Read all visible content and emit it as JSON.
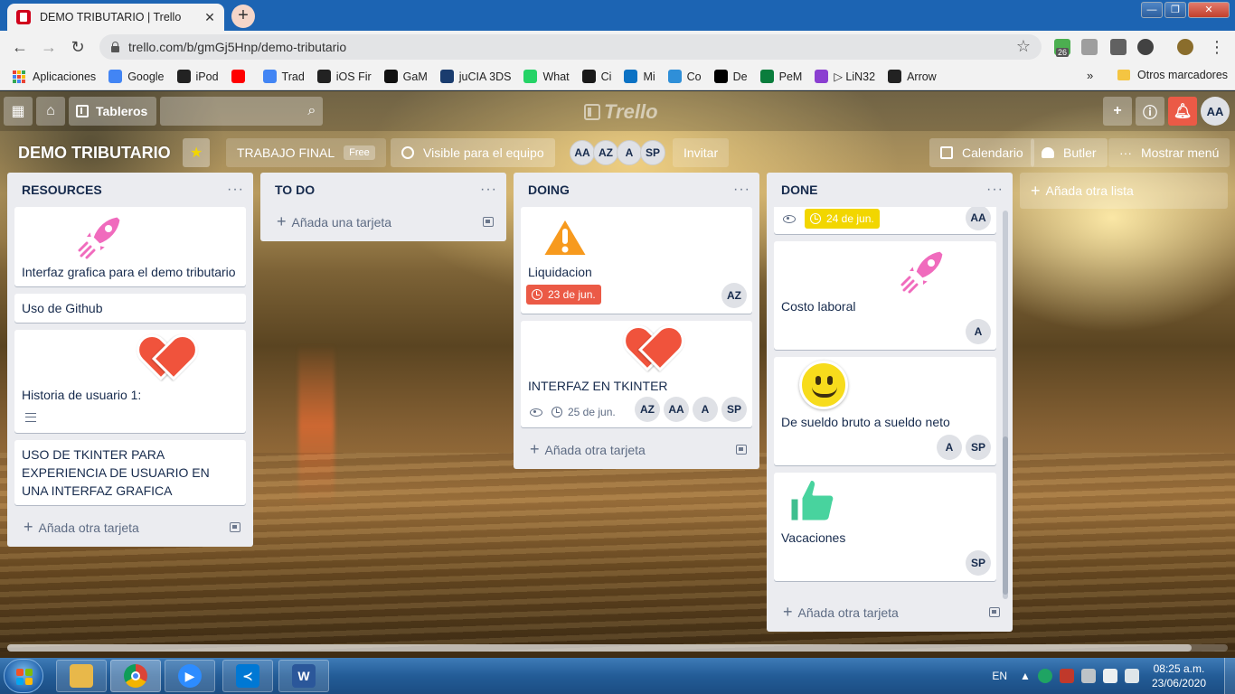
{
  "browser": {
    "tab_title": "DEMO TRIBUTARIO | Trello",
    "tab_close": "✕",
    "new_tab": "+",
    "url": "trello.com/b/gmGj5Hnp/demo-tributario",
    "extension_badge": "26",
    "window_controls": {
      "minimize": "—",
      "maximize": "❐",
      "close": "✕"
    }
  },
  "bookmarks": {
    "items": [
      {
        "label": "Aplicaciones",
        "icon": "apps-grid-icon"
      },
      {
        "label": "Google",
        "icon": "google-icon",
        "color": "#4285f4"
      },
      {
        "label": "iPod",
        "icon": "globe-icon",
        "color": "#222222"
      },
      {
        "label": "",
        "icon": "youtube-icon",
        "color": "#ff0000"
      },
      {
        "label": "Trad",
        "icon": "translate-icon",
        "color": "#4285f4"
      },
      {
        "label": "iOS Fir",
        "icon": "globe-icon",
        "color": "#222222"
      },
      {
        "label": "GaM",
        "icon": "gam-icon",
        "color": "#111111"
      },
      {
        "label": "juCIA 3DS",
        "icon": "jucia-icon",
        "color": "#1a3c6e"
      },
      {
        "label": "What",
        "icon": "whatsapp-icon",
        "color": "#25d366"
      },
      {
        "label": "Ci",
        "icon": "ci-icon",
        "color": "#1a1a1a"
      },
      {
        "label": "Mi",
        "icon": "mi-icon",
        "color": "#0b72c4"
      },
      {
        "label": "Co",
        "icon": "co-icon",
        "color": "#2f8fd8"
      },
      {
        "label": "De",
        "icon": "dc-icon",
        "color": "#000000"
      },
      {
        "label": "PeM",
        "icon": "pem-icon",
        "color": "#0a7d3c"
      },
      {
        "label": "▷ LiN32",
        "icon": "lin32-icon",
        "color": "#8b3fd1"
      },
      {
        "label": "Arrow",
        "icon": "arrow-icon",
        "color": "#222222"
      }
    ],
    "more": "»",
    "other": "Otros marcadores"
  },
  "trello_header": {
    "boards_label": "Tableros",
    "logo_text": "Trello",
    "user_initials": "AA"
  },
  "board": {
    "title": "DEMO TRIBUTARIO",
    "star": "★",
    "team": "TRABAJO FINAL",
    "plan": "Free",
    "visibility": "Visible para el equipo",
    "members": [
      "AA",
      "AZ",
      "A",
      "SP"
    ],
    "invite": "Invitar",
    "calendar": "Calendario",
    "butler": "Butler",
    "menu": "Mostrar menú",
    "add_list": "Añada otra lista"
  },
  "lists": [
    {
      "title": "RESOURCES",
      "menu": "···",
      "add_label": "Añada otra tarjeta",
      "cards": [
        {
          "title": "Interfaz grafica para el demo tributario",
          "sticker": "rocket"
        },
        {
          "title": "Uso de Github"
        },
        {
          "title": "Historia de usuario 1:",
          "sticker": "heart",
          "has_description": true
        },
        {
          "title": "USO DE TKINTER PARA EXPERIENCIA DE USUARIO EN UNA INTERFAZ GRAFICA"
        }
      ]
    },
    {
      "title": "TO DO",
      "menu": "···",
      "add_label": "Añada una tarjeta",
      "cards": []
    },
    {
      "title": "DOING",
      "menu": "···",
      "add_label": "Añada otra tarjeta",
      "cards": [
        {
          "title": "Liquidacion",
          "sticker": "warning",
          "due": "23 de jun.",
          "due_color": "#eb5a46",
          "members": [
            "AZ"
          ]
        },
        {
          "title": "INTERFAZ EN TKINTER",
          "sticker": "heart",
          "watching": true,
          "due": "25 de jun.",
          "members": [
            "AZ",
            "AA",
            "A",
            "SP"
          ]
        }
      ]
    },
    {
      "title": "DONE",
      "menu": "···",
      "add_label": "Añada otra tarjeta",
      "cards": [
        {
          "title": "",
          "watching": true,
          "due": "24 de jun.",
          "due_color": "#f2d600",
          "members": [
            "AA"
          ]
        },
        {
          "title": "Costo laboral",
          "sticker": "rocket",
          "members": [
            "A"
          ]
        },
        {
          "title": "De sueldo bruto a sueldo neto",
          "sticker": "smile",
          "members": [
            "A",
            "SP"
          ]
        },
        {
          "title": "Vacaciones",
          "sticker": "thumbsup",
          "members": [
            "SP"
          ]
        }
      ]
    }
  ],
  "taskbar": {
    "apps": [
      "explorer",
      "chrome",
      "zoom",
      "vscode",
      "word"
    ],
    "language": "EN",
    "time": "08:25 a.m.",
    "date": "23/06/2020"
  }
}
